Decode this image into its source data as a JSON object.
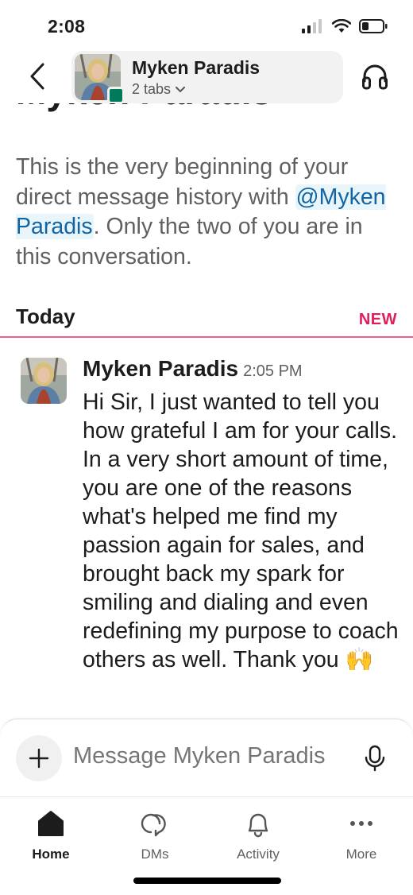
{
  "status_bar": {
    "time": "2:08"
  },
  "header": {
    "name": "Myken Paradis",
    "subtitle": "2 tabs",
    "icons": {
      "back": "chevron-left-icon",
      "headphones": "headphones-icon",
      "dropdown": "chevron-down-icon"
    }
  },
  "conversation": {
    "clipped_title": "Myken Paradis",
    "intro_before": "This is the very beginning of your direct message history with ",
    "intro_mention": "@Myken Paradis",
    "intro_after": ". Only the two of you are in this conversation.",
    "day_label": "Today",
    "new_label": "NEW",
    "message": {
      "author": "Myken Paradis",
      "time": "2:05 PM",
      "text": "Hi Sir, I just wanted to tell you how grateful I am for your calls. In a very short amount of time, you are one of the reasons what's helped me find my passion again for sales, and brought back my spark for smiling and dialing and even redefining my purpose to coach others as well. Thank you 🙌"
    }
  },
  "composer": {
    "placeholder": "Message Myken Paradis",
    "icons": {
      "add": "plus-icon",
      "mic": "microphone-icon"
    }
  },
  "tabbar": {
    "active": "Home",
    "tabs": [
      {
        "label": "Home",
        "icon": "home-icon"
      },
      {
        "label": "DMs",
        "icon": "dms-icon"
      },
      {
        "label": "Activity",
        "icon": "bell-icon"
      },
      {
        "label": "More",
        "icon": "more-icon"
      }
    ]
  },
  "colors": {
    "mention": "#1264a3",
    "new_divider": "#e01e5a",
    "presence": "#007a5a"
  }
}
